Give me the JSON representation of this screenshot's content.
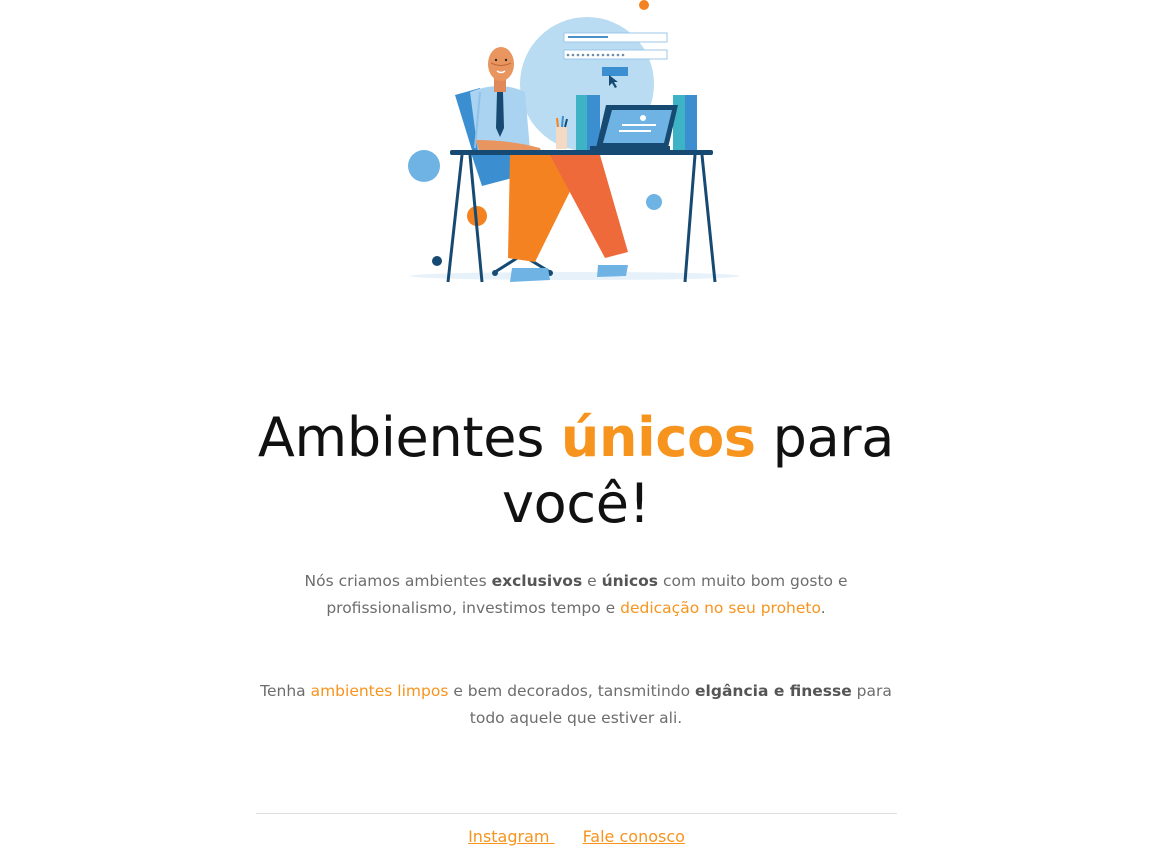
{
  "headline": {
    "part1": "Ambientes ",
    "accent": "únicos",
    "part2": " para",
    "line2": "você!"
  },
  "paragraph1": {
    "t1": "Nós criamos ambientes ",
    "b1": "exclusivos",
    "t2": " e ",
    "b2": "únicos",
    "t3": " com muito bom gosto e profissionalismo, investimos tempo e ",
    "link": "dedicação no seu proheto",
    "t4": "."
  },
  "paragraph2": {
    "t1": "Tenha ",
    "link": "ambientes limpos",
    "t2": " e bem decorados, tansmitindo ",
    "b1": "elgância e finesse",
    "t3": " para todo aquele que estiver ali."
  },
  "footer": {
    "links": [
      {
        "label": "Instagram "
      },
      {
        "label": "Fale conosco"
      }
    ]
  },
  "colors": {
    "accent": "#f7941d",
    "text": "#6d6d6d",
    "headline": "#111111"
  },
  "illustration": {
    "icon": "person-at-desk-illustration"
  }
}
